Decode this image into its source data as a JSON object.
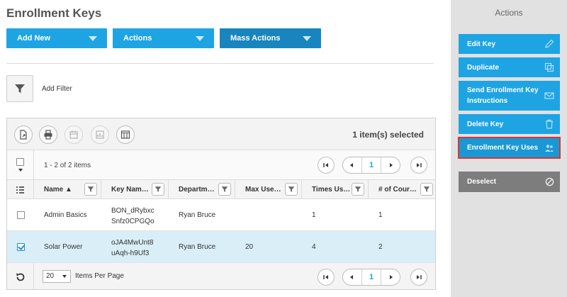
{
  "page": {
    "title": "Enrollment Keys"
  },
  "top_buttons": {
    "add_new": "Add New",
    "actions": "Actions",
    "mass_actions": "Mass Actions"
  },
  "filter": {
    "label": "Add Filter"
  },
  "grid": {
    "selected_text": "1 item(s) selected",
    "count_text": "1 - 2 of 2 items",
    "current_page": "1",
    "columns": [
      "Name ▲",
      "Key Nam…",
      "Departm…",
      "Max Use…",
      "Times Us…",
      "# of Cour…"
    ],
    "rows": [
      {
        "selected": false,
        "name": "Admin Basics",
        "key": "BON_dRybxc\nSnfz0CPGQo",
        "department": "Ryan Bruce",
        "max_uses": "",
        "times_used": "1",
        "courses": "1"
      },
      {
        "selected": true,
        "name": "Solar Power",
        "key": "oJA4MwUnt8\nuAqh-h9Uf3",
        "department": "Ryan Bruce",
        "max_uses": "20",
        "times_used": "4",
        "courses": "2"
      }
    ],
    "per_page_value": "20",
    "per_page_label": "Items Per Page"
  },
  "side": {
    "title": "Actions",
    "actions": [
      "Edit Key",
      "Duplicate",
      "Send Enrollment Key Instructions",
      "Delete Key",
      "Enrollment Key Uses"
    ],
    "deselect": "Deselect"
  },
  "colors": {
    "accent": "#1ea4e3",
    "accent_dark": "#1985bf",
    "selected_row": "#d9eef7",
    "highlight_outline": "#e0342f"
  }
}
